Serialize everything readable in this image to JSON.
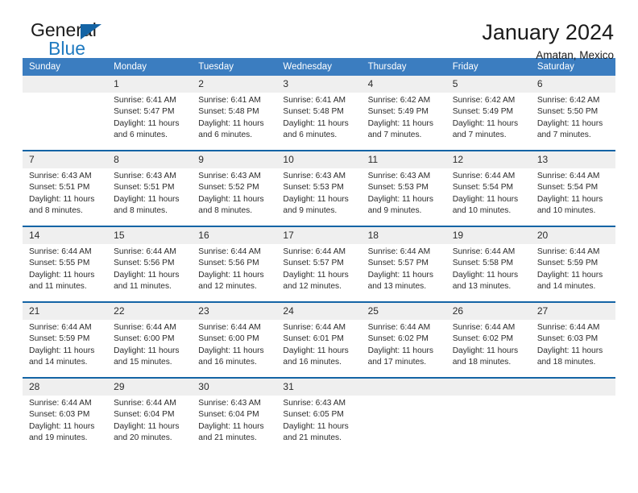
{
  "brand": {
    "name_top": "General",
    "name_bottom": "Blue",
    "triangle_color": "#1464a5",
    "blue_color": "#1f7ac0"
  },
  "header": {
    "title": "January 2024",
    "subtitle": "Amatan, Mexico"
  },
  "colors": {
    "header_blue": "#3b7dc0",
    "separator_blue": "#1464a5",
    "daynum_band": "#efefef"
  },
  "weekday_headers": [
    "Sunday",
    "Monday",
    "Tuesday",
    "Wednesday",
    "Thursday",
    "Friday",
    "Saturday"
  ],
  "weeks": [
    [
      {
        "day": "",
        "lines": []
      },
      {
        "day": "1",
        "lines": [
          "Sunrise: 6:41 AM",
          "Sunset: 5:47 PM",
          "Daylight: 11 hours",
          "and 6 minutes."
        ]
      },
      {
        "day": "2",
        "lines": [
          "Sunrise: 6:41 AM",
          "Sunset: 5:48 PM",
          "Daylight: 11 hours",
          "and 6 minutes."
        ]
      },
      {
        "day": "3",
        "lines": [
          "Sunrise: 6:41 AM",
          "Sunset: 5:48 PM",
          "Daylight: 11 hours",
          "and 6 minutes."
        ]
      },
      {
        "day": "4",
        "lines": [
          "Sunrise: 6:42 AM",
          "Sunset: 5:49 PM",
          "Daylight: 11 hours",
          "and 7 minutes."
        ]
      },
      {
        "day": "5",
        "lines": [
          "Sunrise: 6:42 AM",
          "Sunset: 5:49 PM",
          "Daylight: 11 hours",
          "and 7 minutes."
        ]
      },
      {
        "day": "6",
        "lines": [
          "Sunrise: 6:42 AM",
          "Sunset: 5:50 PM",
          "Daylight: 11 hours",
          "and 7 minutes."
        ]
      }
    ],
    [
      {
        "day": "7",
        "lines": [
          "Sunrise: 6:43 AM",
          "Sunset: 5:51 PM",
          "Daylight: 11 hours",
          "and 8 minutes."
        ]
      },
      {
        "day": "8",
        "lines": [
          "Sunrise: 6:43 AM",
          "Sunset: 5:51 PM",
          "Daylight: 11 hours",
          "and 8 minutes."
        ]
      },
      {
        "day": "9",
        "lines": [
          "Sunrise: 6:43 AM",
          "Sunset: 5:52 PM",
          "Daylight: 11 hours",
          "and 8 minutes."
        ]
      },
      {
        "day": "10",
        "lines": [
          "Sunrise: 6:43 AM",
          "Sunset: 5:53 PM",
          "Daylight: 11 hours",
          "and 9 minutes."
        ]
      },
      {
        "day": "11",
        "lines": [
          "Sunrise: 6:43 AM",
          "Sunset: 5:53 PM",
          "Daylight: 11 hours",
          "and 9 minutes."
        ]
      },
      {
        "day": "12",
        "lines": [
          "Sunrise: 6:44 AM",
          "Sunset: 5:54 PM",
          "Daylight: 11 hours",
          "and 10 minutes."
        ]
      },
      {
        "day": "13",
        "lines": [
          "Sunrise: 6:44 AM",
          "Sunset: 5:54 PM",
          "Daylight: 11 hours",
          "and 10 minutes."
        ]
      }
    ],
    [
      {
        "day": "14",
        "lines": [
          "Sunrise: 6:44 AM",
          "Sunset: 5:55 PM",
          "Daylight: 11 hours",
          "and 11 minutes."
        ]
      },
      {
        "day": "15",
        "lines": [
          "Sunrise: 6:44 AM",
          "Sunset: 5:56 PM",
          "Daylight: 11 hours",
          "and 11 minutes."
        ]
      },
      {
        "day": "16",
        "lines": [
          "Sunrise: 6:44 AM",
          "Sunset: 5:56 PM",
          "Daylight: 11 hours",
          "and 12 minutes."
        ]
      },
      {
        "day": "17",
        "lines": [
          "Sunrise: 6:44 AM",
          "Sunset: 5:57 PM",
          "Daylight: 11 hours",
          "and 12 minutes."
        ]
      },
      {
        "day": "18",
        "lines": [
          "Sunrise: 6:44 AM",
          "Sunset: 5:57 PM",
          "Daylight: 11 hours",
          "and 13 minutes."
        ]
      },
      {
        "day": "19",
        "lines": [
          "Sunrise: 6:44 AM",
          "Sunset: 5:58 PM",
          "Daylight: 11 hours",
          "and 13 minutes."
        ]
      },
      {
        "day": "20",
        "lines": [
          "Sunrise: 6:44 AM",
          "Sunset: 5:59 PM",
          "Daylight: 11 hours",
          "and 14 minutes."
        ]
      }
    ],
    [
      {
        "day": "21",
        "lines": [
          "Sunrise: 6:44 AM",
          "Sunset: 5:59 PM",
          "Daylight: 11 hours",
          "and 14 minutes."
        ]
      },
      {
        "day": "22",
        "lines": [
          "Sunrise: 6:44 AM",
          "Sunset: 6:00 PM",
          "Daylight: 11 hours",
          "and 15 minutes."
        ]
      },
      {
        "day": "23",
        "lines": [
          "Sunrise: 6:44 AM",
          "Sunset: 6:00 PM",
          "Daylight: 11 hours",
          "and 16 minutes."
        ]
      },
      {
        "day": "24",
        "lines": [
          "Sunrise: 6:44 AM",
          "Sunset: 6:01 PM",
          "Daylight: 11 hours",
          "and 16 minutes."
        ]
      },
      {
        "day": "25",
        "lines": [
          "Sunrise: 6:44 AM",
          "Sunset: 6:02 PM",
          "Daylight: 11 hours",
          "and 17 minutes."
        ]
      },
      {
        "day": "26",
        "lines": [
          "Sunrise: 6:44 AM",
          "Sunset: 6:02 PM",
          "Daylight: 11 hours",
          "and 18 minutes."
        ]
      },
      {
        "day": "27",
        "lines": [
          "Sunrise: 6:44 AM",
          "Sunset: 6:03 PM",
          "Daylight: 11 hours",
          "and 18 minutes."
        ]
      }
    ],
    [
      {
        "day": "28",
        "lines": [
          "Sunrise: 6:44 AM",
          "Sunset: 6:03 PM",
          "Daylight: 11 hours",
          "and 19 minutes."
        ]
      },
      {
        "day": "29",
        "lines": [
          "Sunrise: 6:44 AM",
          "Sunset: 6:04 PM",
          "Daylight: 11 hours",
          "and 20 minutes."
        ]
      },
      {
        "day": "30",
        "lines": [
          "Sunrise: 6:43 AM",
          "Sunset: 6:04 PM",
          "Daylight: 11 hours",
          "and 21 minutes."
        ]
      },
      {
        "day": "31",
        "lines": [
          "Sunrise: 6:43 AM",
          "Sunset: 6:05 PM",
          "Daylight: 11 hours",
          "and 21 minutes."
        ]
      },
      {
        "day": "",
        "lines": []
      },
      {
        "day": "",
        "lines": []
      },
      {
        "day": "",
        "lines": []
      }
    ]
  ]
}
